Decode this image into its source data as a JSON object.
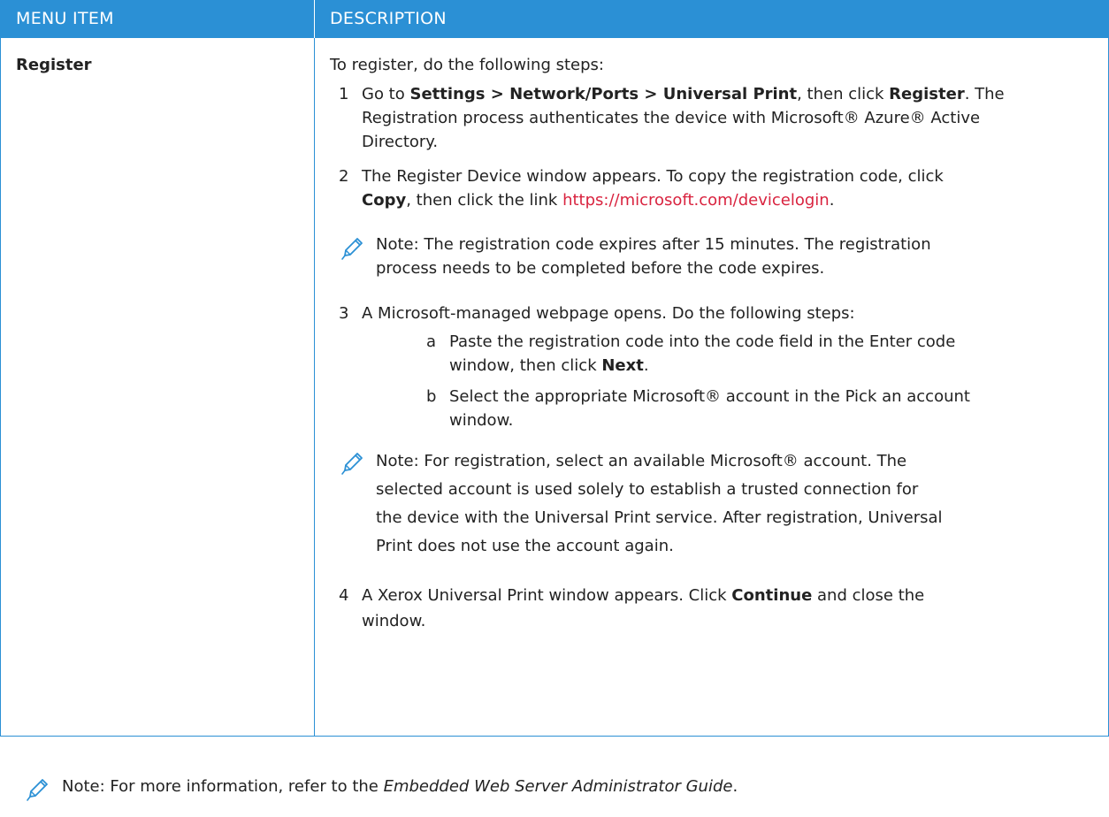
{
  "header": {
    "col1": "MENU ITEM",
    "col2": "DESCRIPTION"
  },
  "row": {
    "menu_item": "Register"
  },
  "intro": "To register, do the following steps:",
  "step1": {
    "num": "1",
    "a": "Go to ",
    "path": "Settings > Network/Ports > Universal Print",
    "b": ", then click ",
    "btn": "Register",
    "c": ". The",
    "line2": "Registration process authenticates the device with Microsoft® Azure® Active",
    "line3": "Directory."
  },
  "step2": {
    "num": "2",
    "line1": "The Register Device window appears. To copy the registration code, click",
    "btn": "Copy",
    "mid": ", then click the link ",
    "link": "https://microsoft.com/devicelogin",
    "end": "."
  },
  "note1": {
    "line1": "Note: The registration code expires after 15 minutes. The registration",
    "line2": "process needs to be completed before the code expires."
  },
  "step3": {
    "num": "3",
    "line1": "A Microsoft-managed webpage opens. Do the following steps:",
    "sub_a": {
      "label": "a",
      "line1": "Paste the registration code into the code field in the Enter code",
      "line2a": "window, then click ",
      "btn": "Next",
      "line2b": "."
    },
    "sub_b": {
      "label": "b",
      "line1": "Select the appropriate Microsoft® account in the Pick an account",
      "line2": "window."
    }
  },
  "note2": {
    "line1": "Note: For registration, select an available Microsoft® account. The",
    "line2": "selected account is used solely to establish a trusted connection for",
    "line3": "the device with the Universal Print service. After registration, Universal",
    "line4": "Print does not use the account again."
  },
  "step4": {
    "num": "4",
    "a": "A Xerox Universal Print window appears. Click ",
    "btn": "Continue",
    "b": " and close the",
    "line2": "window."
  },
  "footer_note": {
    "a": "Note: For more information, refer to the ",
    "guide": "Embedded Web Server Administrator Guide",
    "b": "."
  },
  "colors": {
    "header_bg": "#2b90d5",
    "link": "#d9233f",
    "pencil": "#2b90d5"
  }
}
